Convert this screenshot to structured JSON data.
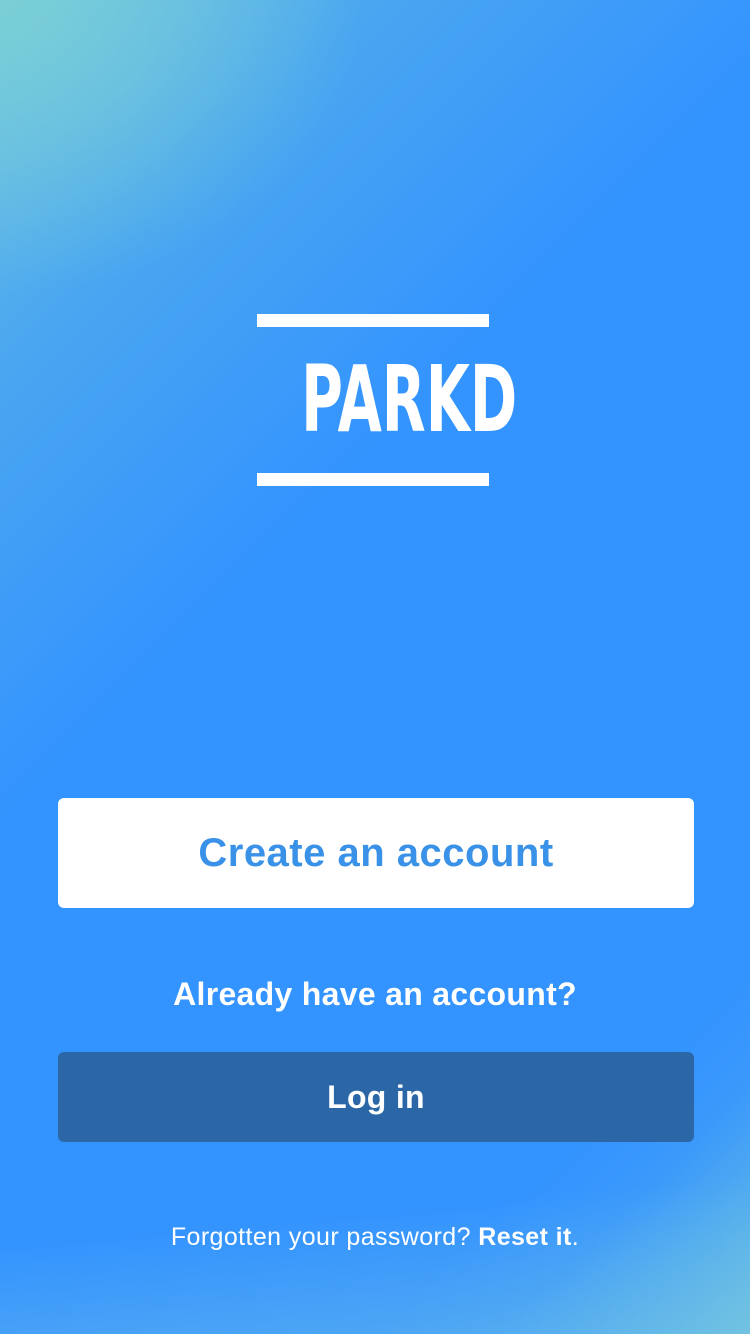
{
  "app": {
    "logo_text": "PARKD"
  },
  "actions": {
    "create_account_label": "Create an account",
    "already_have_account_text": "Already have an account?",
    "login_label": "Log in"
  },
  "password_reset": {
    "prompt_text": "Forgotten your password?",
    "reset_link_label": "Reset it",
    "trailing_punctuation": "."
  },
  "colors": {
    "background": "#3393ff",
    "primary_button_bg": "#ffffff",
    "primary_button_text": "#3a92e8",
    "secondary_button_bg": "#2b67a7",
    "text_on_background": "#ffffff"
  }
}
